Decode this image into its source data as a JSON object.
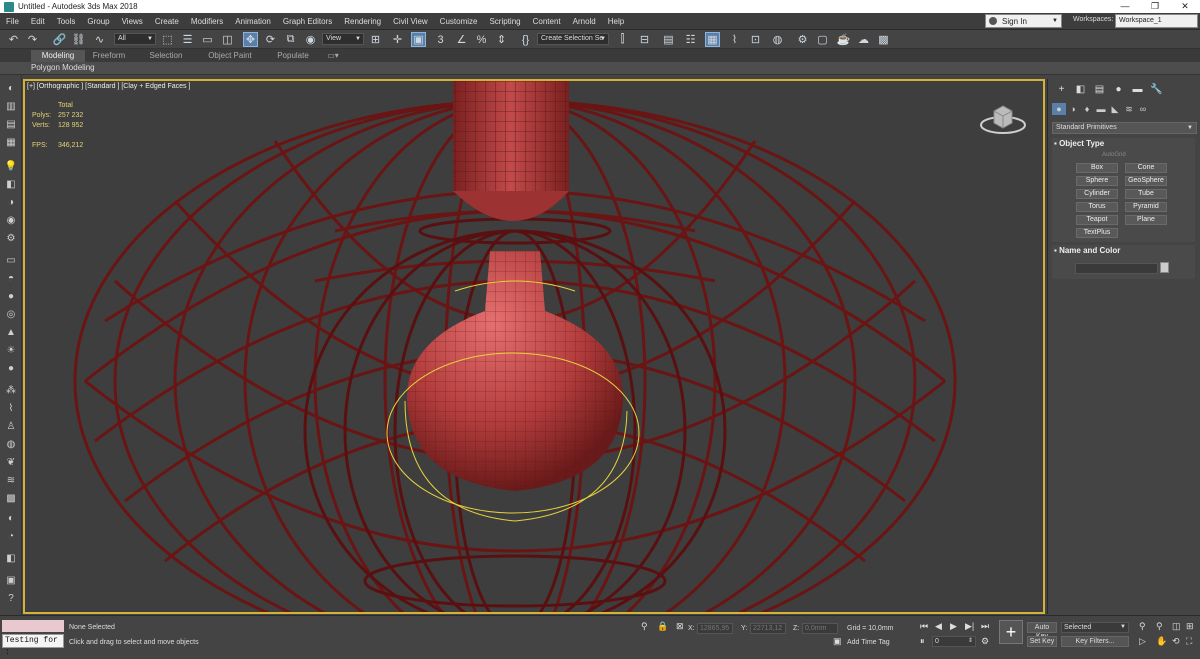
{
  "window": {
    "title": "Untitled - Autodesk 3ds Max 2018",
    "controls": [
      "—",
      "❐",
      "✕"
    ]
  },
  "menu": [
    "File",
    "Edit",
    "Tools",
    "Group",
    "Views",
    "Create",
    "Modifiers",
    "Animation",
    "Graph Editors",
    "Rendering",
    "Civil View",
    "Customize",
    "Scripting",
    "Content",
    "Arnold",
    "Help"
  ],
  "account": {
    "sign_in": "Sign In",
    "workspaces_label": "Workspaces:",
    "workspace": "Workspace_1"
  },
  "toolbar": {
    "filter": "All",
    "ref_coord": "View",
    "selection_set": "Create Selection Se"
  },
  "ribbon": {
    "tabs": [
      "Modeling",
      "Freeform",
      "Selection",
      "Object Paint",
      "Populate"
    ],
    "active_tab": "Modeling",
    "panel": "Polygon Modeling"
  },
  "viewport": {
    "label": "[+] [Orthographic ] [Standard ] [Clay + Edged Faces ]",
    "stats_total": "Total",
    "polys_label": "Polys:",
    "polys": "257 232",
    "verts_label": "Verts:",
    "verts": "128 952",
    "fps_label": "FPS:",
    "fps": "346,212"
  },
  "command_panel": {
    "category": "Standard Primitives",
    "object_type_header": "Object Type",
    "autogrid": "AutoGrid",
    "primitives": [
      "Box",
      "Cone",
      "Sphere",
      "GeoSphere",
      "Cylinder",
      "Tube",
      "Torus",
      "Pyramid",
      "Teapot",
      "Plane",
      "TextPlus"
    ],
    "name_color_header": "Name and Color"
  },
  "status": {
    "maxscript": "Testing for :",
    "selection": "None Selected",
    "prompt": "Click and drag to select and move objects",
    "x_label": "X:",
    "x": "12865,95",
    "y_label": "Y:",
    "y": "22713,12",
    "z_label": "Z:",
    "z": "0,0mm",
    "grid": "Grid = 10,0mm",
    "add_time_tag": "Add Time Tag",
    "frame": "0",
    "auto_key": "Auto Key",
    "set_key": "Set Key",
    "key_mode": "Selected",
    "key_filters": "Key Filters..."
  },
  "colors": {
    "accent": "#5a7fa8",
    "viewport_border": "#d4b23a",
    "wireframe": "#6b1414",
    "mesh_face": "#b84040",
    "selection": "#e6d23c"
  }
}
